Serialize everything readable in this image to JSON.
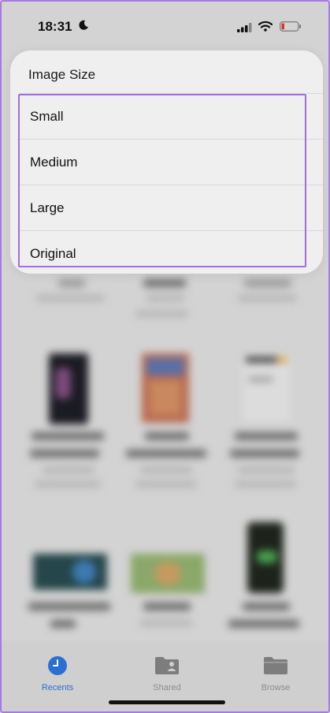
{
  "status_bar": {
    "time": "18:31",
    "icons": [
      "moon-icon",
      "signal-icon",
      "wifi-icon",
      "battery-icon"
    ]
  },
  "menu": {
    "title": "Image Size",
    "items": [
      {
        "label": "Small"
      },
      {
        "label": "Medium"
      },
      {
        "label": "Large"
      },
      {
        "label": "Original"
      }
    ]
  },
  "tab_bar": {
    "tabs": [
      {
        "label": "Recents",
        "icon": "clock-icon",
        "active": true
      },
      {
        "label": "Shared",
        "icon": "shared-folder-icon",
        "active": false
      },
      {
        "label": "Browse",
        "icon": "folder-icon",
        "active": false
      }
    ]
  },
  "colors": {
    "accent": "#2b6fd0",
    "highlight": "#a46ce8",
    "inactive": "#8d8d8d"
  }
}
